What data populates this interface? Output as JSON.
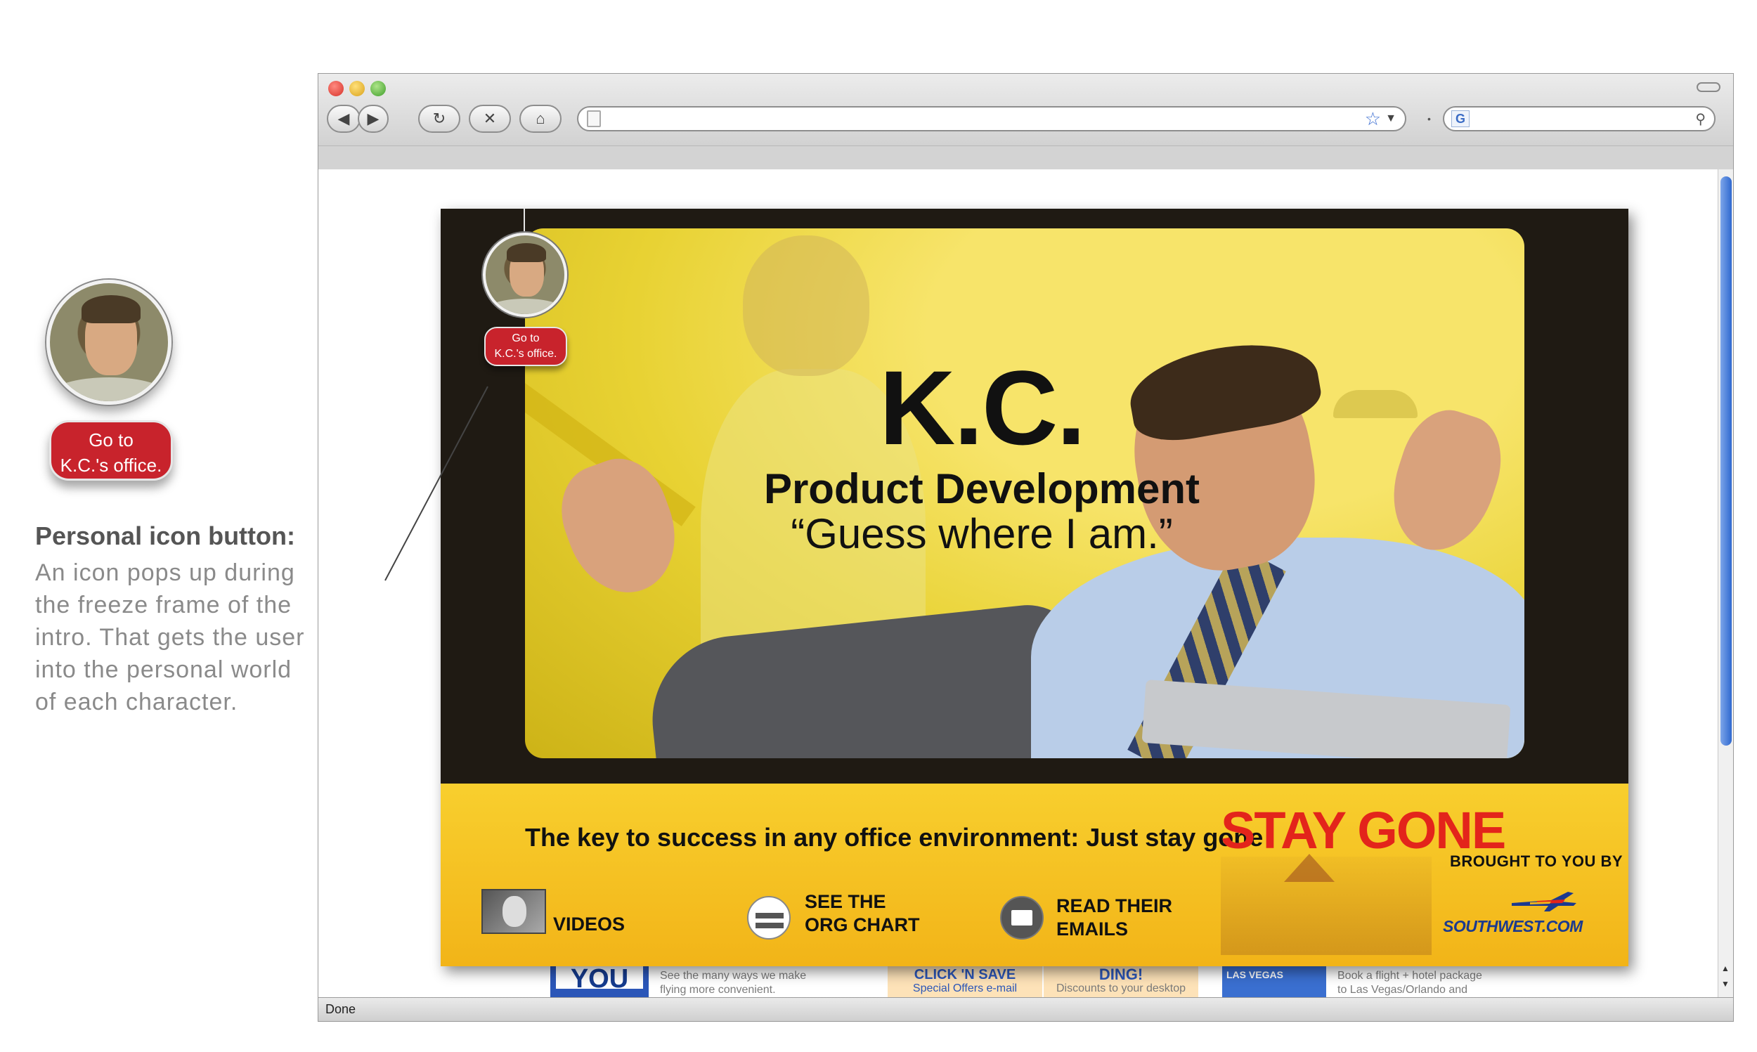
{
  "annotation": {
    "button_label_line1": "Go to",
    "button_label_line2": "K.C.'s office.",
    "title": "Personal icon button:",
    "body_line1": "An icon pops up during",
    "body_line2": "the freeze frame of the",
    "body_line3": "intro. That gets the user",
    "body_line4": "into the personal world",
    "body_line5": "of each character."
  },
  "browser": {
    "status": "Done",
    "search_engine_icon": "G"
  },
  "ad": {
    "character_name": "K.C.",
    "department": "Product Development",
    "quote": "“Guess where I am.”",
    "icon_button_line1": "Go to",
    "icon_button_line2": "K.C.'s office.",
    "tagline": "The key to success in any office environment: Just stay gone",
    "nav": {
      "videos": "VIDEOS",
      "org_line1": "SEE THE",
      "org_line2": "ORG CHART",
      "email_line1": "READ THEIR",
      "email_line2": "EMAILS"
    },
    "campaign": "STAY GONE",
    "sponsor_label": "BROUGHT TO YOU BY",
    "sponsor": "SOUTHWEST.COM",
    "colors": {
      "accent_red": "#e3241b",
      "footer_yellow": "#f8cf2e",
      "sponsor_blue": "#1b3a8f"
    }
  },
  "underlying_page": {
    "you_flying": "YOU",
    "text1_line1": "See the many ways we make",
    "text1_line2": "flying more convenient.",
    "click_title": "CLICK 'N SAVE",
    "click_sub": "Special Offers e-mail",
    "ding_title": "DING!",
    "ding_sub": "Discounts to your desktop",
    "vegas": "LAS VEGAS",
    "text2_line1": "Book a flight + hotel package",
    "text2_line2": "to Las Vegas/Orlando and"
  }
}
